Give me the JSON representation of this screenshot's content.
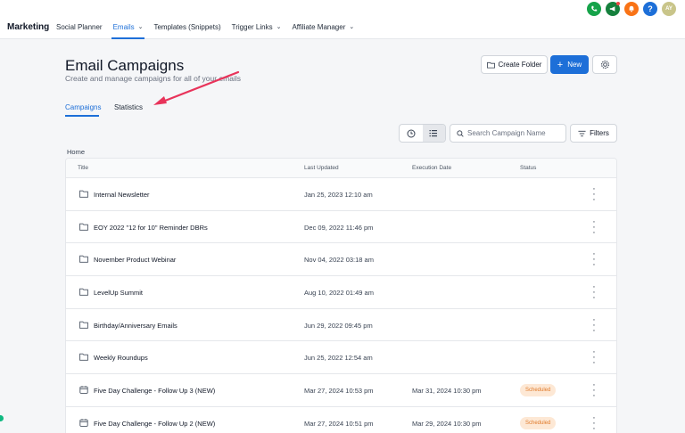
{
  "app": {
    "brand": "Marketing",
    "nav": [
      {
        "label": "Social Planner",
        "dropdown": false,
        "active": false
      },
      {
        "label": "Emails",
        "dropdown": true,
        "active": true
      },
      {
        "label": "Templates (Snippets)",
        "dropdown": false,
        "active": false
      },
      {
        "label": "Trigger Links",
        "dropdown": true,
        "active": false
      },
      {
        "label": "Affiliate Manager",
        "dropdown": true,
        "active": false
      }
    ],
    "top_icons": [
      {
        "name": "phone-icon",
        "color": "#16a34a"
      },
      {
        "name": "megaphone-icon",
        "color": "#15803d"
      },
      {
        "name": "bell-icon",
        "color": "#f97316"
      },
      {
        "name": "help-icon",
        "color": "#1d6fd8",
        "glyph": "?"
      },
      {
        "name": "avatar",
        "color": "#c9c58a",
        "glyph": "AY"
      }
    ]
  },
  "header": {
    "title": "Email Campaigns",
    "subtitle": "Create and manage campaigns for all of your emails",
    "create_folder_label": "Create Folder",
    "new_label": "New"
  },
  "tabs": [
    {
      "label": "Campaigns",
      "active": true
    },
    {
      "label": "Statistics",
      "active": false
    }
  ],
  "toolbar": {
    "search_placeholder": "Search Campaign Name",
    "filters_label": "Filters"
  },
  "breadcrumb": "Home",
  "table": {
    "columns": [
      "Title",
      "Last Updated",
      "Execution Date",
      "Status"
    ],
    "rows": [
      {
        "type": "folder",
        "title": "Internal Newsletter",
        "updated": "Jan 25, 2023 12:10 am",
        "execution": "",
        "status": ""
      },
      {
        "type": "folder",
        "title": "EOY 2022 \"12 for 10\" Reminder DBRs",
        "updated": "Dec 09, 2022 11:46 pm",
        "execution": "",
        "status": ""
      },
      {
        "type": "folder",
        "title": "November Product Webinar",
        "updated": "Nov 04, 2022 03:18 am",
        "execution": "",
        "status": ""
      },
      {
        "type": "folder",
        "title": "LevelUp Summit",
        "updated": "Aug 10, 2022 01:49 am",
        "execution": "",
        "status": ""
      },
      {
        "type": "folder",
        "title": "Birthday/Anniversary Emails",
        "updated": "Jun 29, 2022 09:45 pm",
        "execution": "",
        "status": ""
      },
      {
        "type": "folder",
        "title": "Weekly Roundups",
        "updated": "Jun 25, 2022 12:54 am",
        "execution": "",
        "status": ""
      },
      {
        "type": "campaign",
        "title": "Five Day Challenge - Follow Up 3 (NEW)",
        "updated": "Mar 27, 2024 10:53 pm",
        "execution": "Mar 31, 2024 10:30 pm",
        "status": "Scheduled"
      },
      {
        "type": "campaign",
        "title": "Five Day Challenge - Follow Up 2 (NEW)",
        "updated": "Mar 27, 2024 10:51 pm",
        "execution": "Mar 29, 2024 10:30 pm",
        "status": "Scheduled"
      }
    ]
  },
  "colors": {
    "accent": "#1d6fd8",
    "annotation_arrow": "#e8335a",
    "scheduled_bg": "#fde8d5",
    "scheduled_text": "#e07a2a"
  }
}
